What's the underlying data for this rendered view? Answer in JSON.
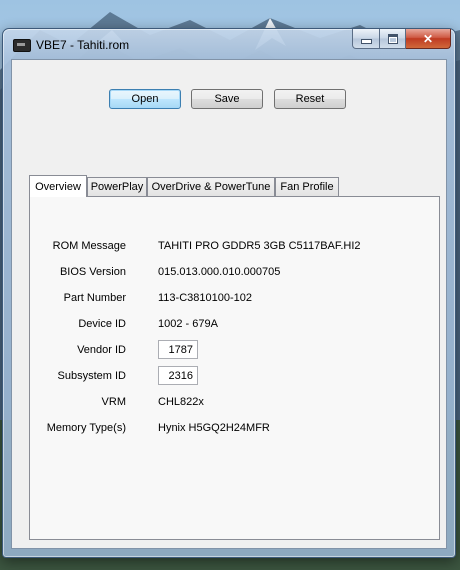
{
  "window": {
    "title": "VBE7 - Tahiti.rom"
  },
  "toolbar": {
    "open_label": "Open",
    "save_label": "Save",
    "reset_label": "Reset"
  },
  "tabs": [
    {
      "label": "Overview",
      "active": true
    },
    {
      "label": "PowerPlay",
      "active": false
    },
    {
      "label": "OverDrive & PowerTune",
      "active": false
    },
    {
      "label": "Fan Profile",
      "active": false
    }
  ],
  "overview": {
    "rom_message": {
      "label": "ROM Message",
      "value": "TAHITI PRO GDDR5 3GB C5117BAF.HI2"
    },
    "bios_version": {
      "label": "BIOS Version",
      "value": "015.013.000.010.000705"
    },
    "part_number": {
      "label": "Part Number",
      "value": "113-C3810100-102"
    },
    "device_id": {
      "label": "Device ID",
      "value": "1002 - 679A"
    },
    "vendor_id": {
      "label": "Vendor ID",
      "value": "1787"
    },
    "subsystem_id": {
      "label": "Subsystem ID",
      "value": "2316"
    },
    "vrm": {
      "label": "VRM",
      "value": "CHL822x"
    },
    "memory_type": {
      "label": "Memory Type(s)",
      "value": "Hynix H5GQ2H24MFR"
    }
  },
  "colors": {
    "default_button_border": "#3c7fb1",
    "close_button": "#c7462f",
    "window_frame": "#aac3de"
  },
  "icons": {
    "app": "gpu-card-icon",
    "minimize": "minimize-icon",
    "maximize": "maximize-icon",
    "close": "close-icon"
  }
}
